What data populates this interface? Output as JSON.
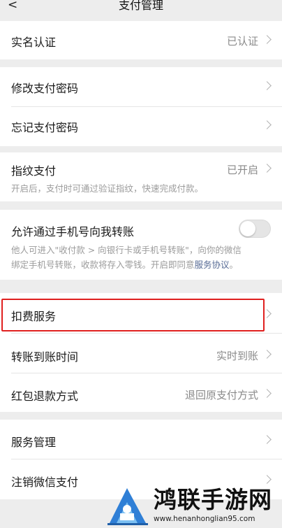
{
  "nav": {
    "title": "支付管理"
  },
  "verify": {
    "label": "实名认证",
    "value": "已认证"
  },
  "password": {
    "change_label": "修改支付密码",
    "forgot_label": "忘记支付密码"
  },
  "fingerprint": {
    "label": "指纹支付",
    "value": "已开启",
    "desc": "开启后，支付时可通过验证指纹，快速完成付款。"
  },
  "phone_transfer": {
    "label": "允许通过手机号向我转账",
    "enabled": false,
    "desc_line1": "他人可进入\"收付款 > 向银行卡或手机号转账\"，向你的微信",
    "desc_line2": "绑定手机号转账，收款将存入零钱。开启即同意",
    "desc_link": "服务协议",
    "desc_end": "。"
  },
  "deduction": {
    "label": "扣费服务"
  },
  "arrival_time": {
    "label": "转账到账时间",
    "value": "实时到账"
  },
  "redpacket_refund": {
    "label": "红包退款方式",
    "value": "退回原支付方式"
  },
  "service": {
    "manage_label": "服务管理",
    "cancel_label": "注销微信支付"
  },
  "watermark": {
    "title": "鸿联手游网",
    "url": "www.henanhonglian95.com"
  },
  "colors": {
    "highlight_border": "#e0201f",
    "link": "#576b95",
    "background": "#ededed"
  }
}
